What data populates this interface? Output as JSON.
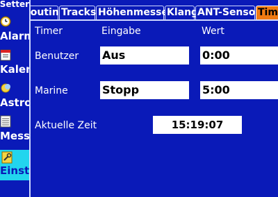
{
  "sidebar": {
    "title": "Setter",
    "items": [
      {
        "label": "Alarme",
        "icon": "alarm-clock-icon"
      },
      {
        "label": "Kalender",
        "icon": "calendar-icon"
      },
      {
        "label": "Astro",
        "icon": "sun-moon-icon"
      },
      {
        "label": "Message",
        "icon": "message-list-icon"
      },
      {
        "label": "Einstellungen",
        "icon": "wrench-icon"
      }
    ]
  },
  "tabs": [
    "Routing",
    "Tracks",
    "Höhenmesser",
    "Klang",
    "ANT-Sensor",
    "Timer"
  ],
  "active_tab": "Timer",
  "table": {
    "headers": [
      "Timer",
      "Eingabe",
      "Wert"
    ],
    "rows": [
      {
        "label": "Benutzer",
        "input": "Aus",
        "value": "0:00"
      },
      {
        "label": "Marine",
        "input": "Stopp",
        "value": "5:00"
      }
    ]
  },
  "current_time": {
    "label": "Aktuelle Zeit",
    "value": "15:19:07"
  },
  "colors": {
    "background": "#0a1ab8",
    "active_tab": "#f07a12",
    "selected_sidebar": "#22d5ee"
  }
}
